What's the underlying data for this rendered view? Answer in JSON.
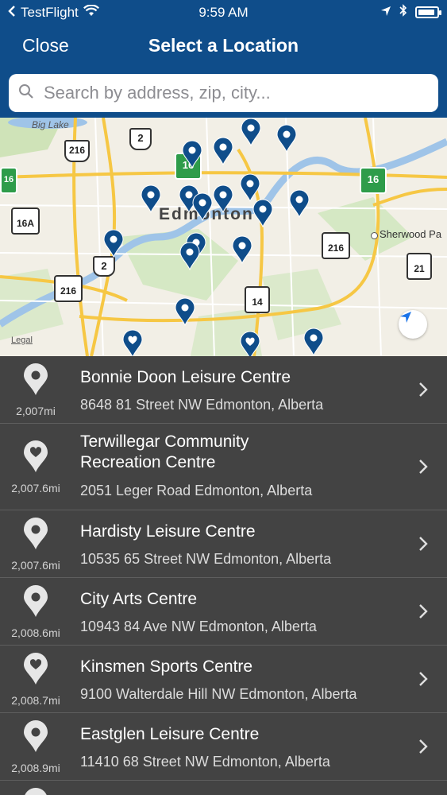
{
  "status_bar": {
    "carrier": "TestFlight",
    "time": "9:59 AM"
  },
  "nav": {
    "close_label": "Close",
    "title": "Select a Location"
  },
  "search": {
    "placeholder": "Search by address, zip, city..."
  },
  "map": {
    "labels": {
      "big_lake": "Big Lake",
      "city": "Edmonton",
      "sherwood": "Sherwood Pa",
      "legal": "Legal"
    },
    "shields": [
      "216",
      "2",
      "16",
      "16",
      "16A",
      "2",
      "216",
      "216",
      "14",
      "21",
      "16"
    ]
  },
  "locations": [
    {
      "name": "Bonnie Doon Leisure Centre",
      "address": "8648 81 Street NW Edmonton, Alberta",
      "distance": "2,007mi",
      "icon": "map-pin-icon"
    },
    {
      "name": "Terwillegar Community Recreation Centre",
      "name_line1": "Terwillegar Community",
      "name_line2": "Recreation Centre",
      "address": "2051 Leger Road Edmonton, Alberta",
      "distance": "2,007.6mi",
      "icon": "heart-pin-icon"
    },
    {
      "name": "Hardisty Leisure Centre",
      "address": "10535 65 Street NW Edmonton, Alberta",
      "distance": "2,007.6mi",
      "icon": "map-pin-icon"
    },
    {
      "name": "City Arts Centre",
      "address": "10943 84 Ave NW Edmonton, Alberta",
      "distance": "2,008.6mi",
      "icon": "map-pin-icon"
    },
    {
      "name": "Kinsmen Sports Centre",
      "address": "9100 Walterdale Hill NW Edmonton, Alberta",
      "distance": "2,008.7mi",
      "icon": "heart-pin-icon"
    },
    {
      "name": "Eastglen Leisure Centre",
      "address": "11410 68 Street NW Edmonton, Alberta",
      "distance": "2,008.9mi",
      "icon": "map-pin-icon"
    }
  ],
  "colors": {
    "header": "#0f4d8a",
    "pin": "#0f4d8a",
    "list_bg": "#434343"
  }
}
